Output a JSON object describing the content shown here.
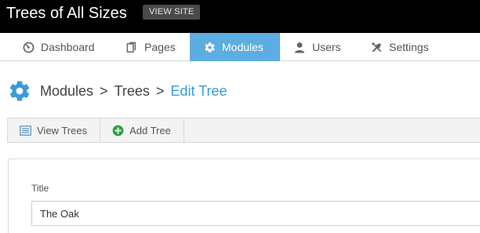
{
  "header": {
    "site_title": "Trees of All Sizes",
    "view_site_label": "VIEW SITE"
  },
  "nav": {
    "tabs": [
      {
        "label": "Dashboard",
        "icon": "dashboard-icon",
        "active": false
      },
      {
        "label": "Pages",
        "icon": "pages-icon",
        "active": false
      },
      {
        "label": "Modules",
        "icon": "gear-icon",
        "active": true
      },
      {
        "label": "Users",
        "icon": "user-icon",
        "active": false
      },
      {
        "label": "Settings",
        "icon": "wrench-screwdriver-icon",
        "active": false
      }
    ]
  },
  "breadcrumb": {
    "icon": "gear-icon",
    "items": [
      "Modules",
      "Trees",
      "Edit Tree"
    ],
    "separator": ">"
  },
  "toolbar": {
    "buttons": [
      {
        "label": "View Trees",
        "icon": "list-icon"
      },
      {
        "label": "Add Tree",
        "icon": "plus-circle-icon"
      }
    ]
  },
  "form": {
    "title_label": "Title",
    "title_value": "The Oak"
  },
  "colors": {
    "topbar_bg": "#000000",
    "active_tab_bg": "#5dade2",
    "breadcrumb_current": "#3a9ad9",
    "gear_blue": "#3a9ad9",
    "add_green": "#2e9e3e"
  }
}
